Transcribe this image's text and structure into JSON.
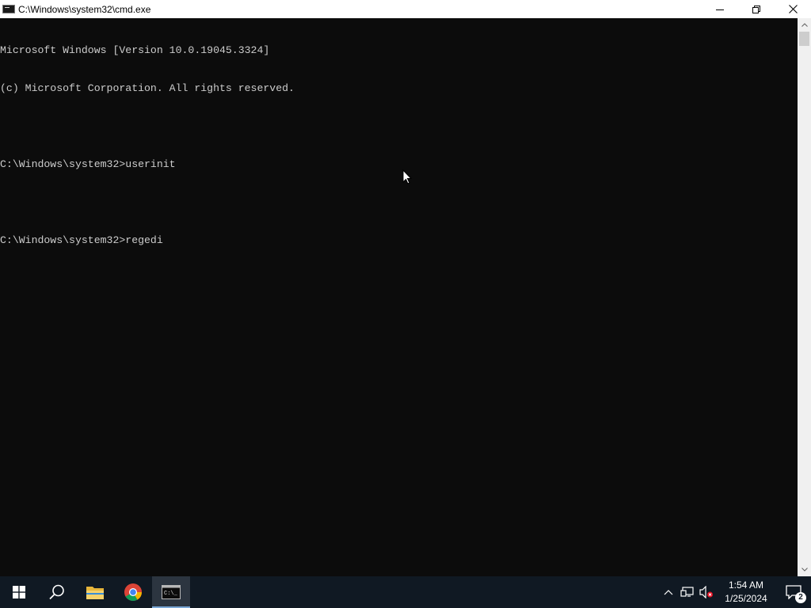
{
  "window": {
    "title": "C:\\Windows\\system32\\cmd.exe",
    "minimize_icon": "minimize-icon",
    "maximize_icon": "restore-icon",
    "close_icon": "close-icon"
  },
  "console": {
    "lines": [
      "Microsoft Windows [Version 10.0.19045.3324]",
      "(c) Microsoft Corporation. All rights reserved.",
      "",
      "C:\\Windows\\system32>userinit",
      "",
      "C:\\Windows\\system32>regedi"
    ],
    "background": "#0c0c0c",
    "foreground": "#cccccc"
  },
  "taskbar": {
    "items": [
      {
        "name": "start-button",
        "icon": "windows-logo-icon"
      },
      {
        "name": "search-button",
        "icon": "search-icon"
      },
      {
        "name": "file-explorer-button",
        "icon": "folder-icon"
      },
      {
        "name": "chrome-button",
        "icon": "chrome-icon"
      },
      {
        "name": "cmd-button",
        "icon": "terminal-icon",
        "active": true
      }
    ],
    "tray": {
      "time": "1:54 AM",
      "date": "1/25/2024",
      "notification_count": "2"
    },
    "background": "#101923"
  }
}
